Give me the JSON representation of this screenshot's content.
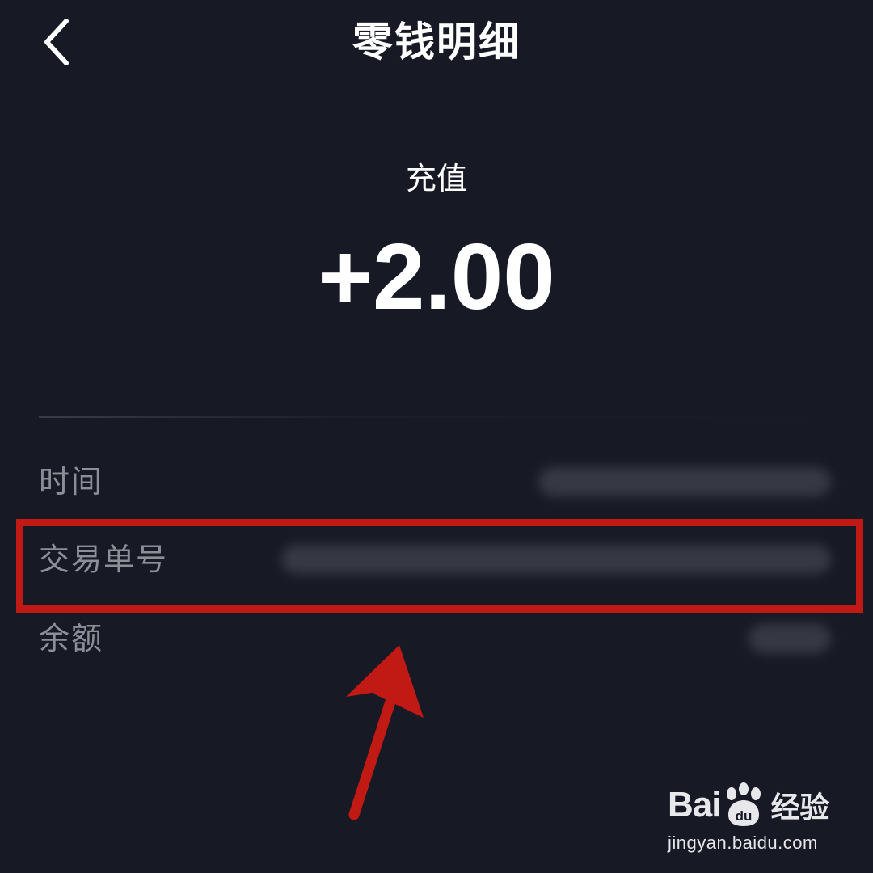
{
  "header": {
    "back_icon": "chevron-left-icon",
    "title": "零钱明细"
  },
  "transaction": {
    "type": "充值",
    "amount": "+2.00"
  },
  "details": [
    {
      "label": "时间",
      "value_obscured": true
    },
    {
      "label": "交易单号",
      "value_obscured": true
    },
    {
      "label": "余额",
      "value_obscured": true
    }
  ],
  "annotation": {
    "highlight_color": "#c11a14",
    "arrow_icon": "arrow-up-icon"
  },
  "watermark": {
    "brand_left": "Bai",
    "brand_paw_text": "du",
    "brand_cn": "经验",
    "url": "jingyan.baidu.com"
  },
  "colors": {
    "background": "#171a25",
    "text_primary": "#ffffff",
    "text_secondary": "#8d8f98"
  }
}
